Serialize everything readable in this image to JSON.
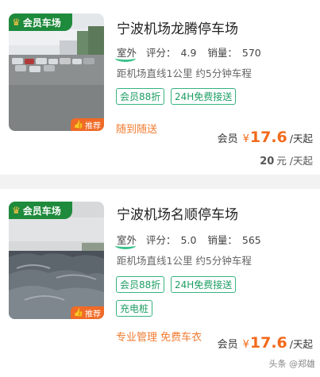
{
  "listings": [
    {
      "member_tag": "会员车场",
      "recommend_tag": "推荐",
      "title": "宁波机场龙腾停车场",
      "type": "室外",
      "rating_label": "评分：",
      "rating": "4.9",
      "sales_label": "销量：",
      "sales": "570",
      "distance": "距机场直线1公里 约5分钟车程",
      "badges": [
        "会员88折",
        "24H免费接送"
      ],
      "promo": "随到随送",
      "price_label": "会员",
      "currency": "¥",
      "price": "17.6",
      "unit": "/天起",
      "original_price": "20",
      "original_unit": "元 /天起"
    },
    {
      "member_tag": "会员车场",
      "recommend_tag": "推荐",
      "title": "宁波机场名顺停车场",
      "type": "室外",
      "rating_label": "评分：",
      "rating": "5.0",
      "sales_label": "销量：",
      "sales": "565",
      "distance": "距机场直线1公里 约5分钟车程",
      "badges": [
        "会员88折",
        "24H免费接送",
        "充电桩"
      ],
      "promo": "专业管理 免费车衣",
      "price_label": "会员",
      "currency": "¥",
      "price": "17.6",
      "unit": "/天起",
      "watermark": "头条 @郑雄"
    }
  ],
  "colors": {
    "accent_green": "#1e8a3c",
    "badge_green": "#36b37e",
    "price_orange": "#f26a1b",
    "recommend_orange": "#f06a27"
  }
}
